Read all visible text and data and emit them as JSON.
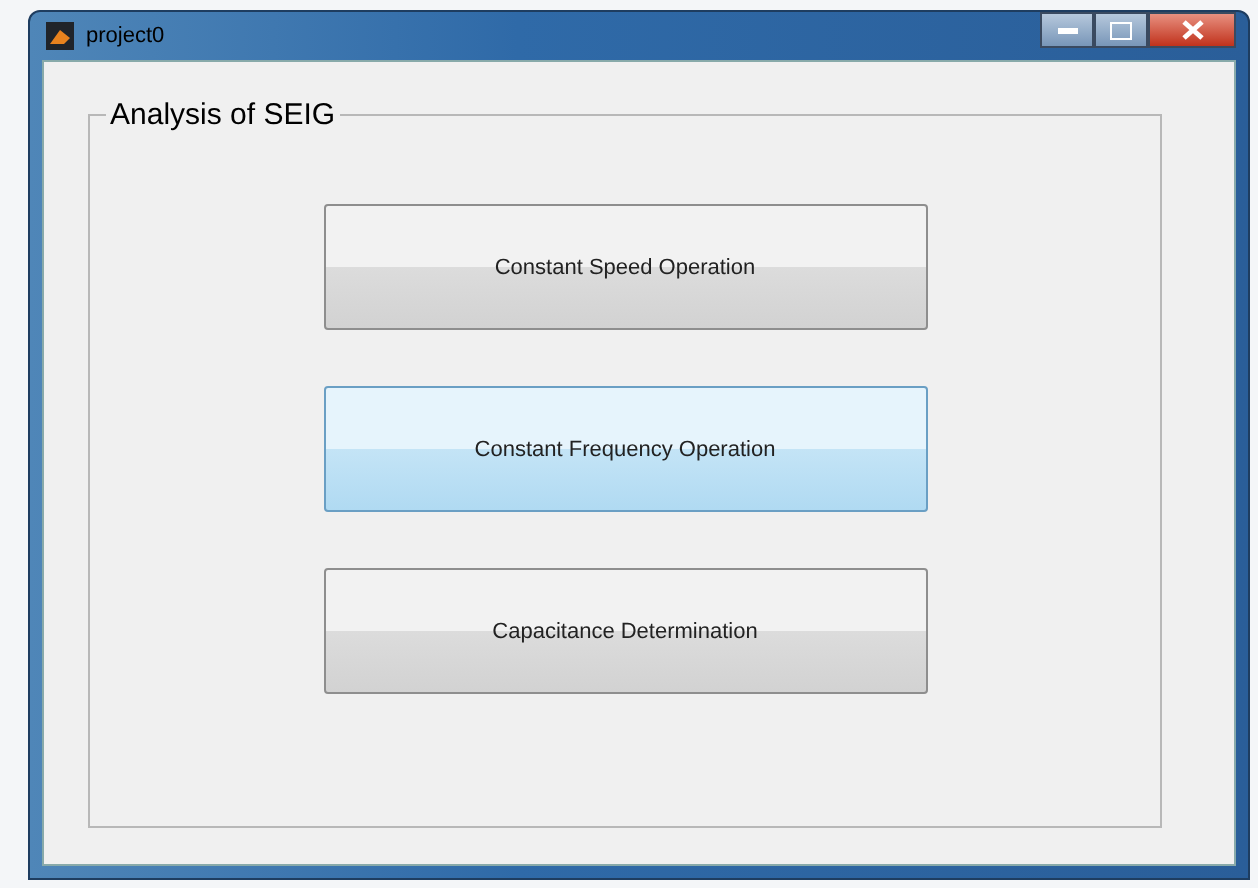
{
  "window": {
    "title": "project0"
  },
  "panel": {
    "title": "Analysis of SEIG"
  },
  "buttons": [
    {
      "label": "Constant Speed Operation",
      "hovered": false
    },
    {
      "label": "Constant Frequency Operation",
      "hovered": true
    },
    {
      "label": "Capacitance Determination",
      "hovered": false
    }
  ]
}
